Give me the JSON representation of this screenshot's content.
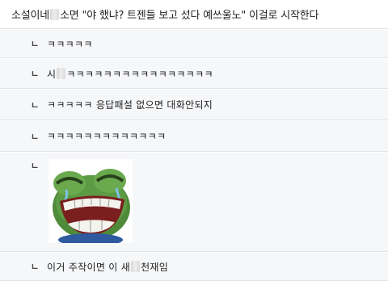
{
  "post": {
    "part1": "소설이네 ",
    "part2": "소면 \"야 했냐? 트젠들 보고 섰다 예쓰울노\" 이걸로 시작한다"
  },
  "replies": [
    {
      "arrow": "ㄴ",
      "text": "ㅋㅋㅋㅋㅋ"
    },
    {
      "arrow": "ㄴ",
      "pre": "시",
      "text": "ㅋㅋㅋㅋㅋㅋㅋㅋㅋㅋㅋㅋㅋㅋㅋㅋ"
    },
    {
      "arrow": "ㄴ",
      "text": "ㅋㅋㅋㅋㅋ 응답패설 없으면 대화안되지"
    },
    {
      "arrow": "ㄴ",
      "text": "ㅋㅋㅋㅋㅋㅋㅋㅋㅋㅋㅋㅋㅋ"
    },
    {
      "arrow": "ㄴ",
      "image": "laughing-frog-emoticon"
    },
    {
      "arrow": "ㄴ",
      "pre": "이거 주작이면 이 새",
      "text": " 천재임"
    }
  ],
  "colors": {
    "reply_bg": "#f6f7f9",
    "divider": "#e2e3e6",
    "frog_green": "#4f8a3a"
  }
}
